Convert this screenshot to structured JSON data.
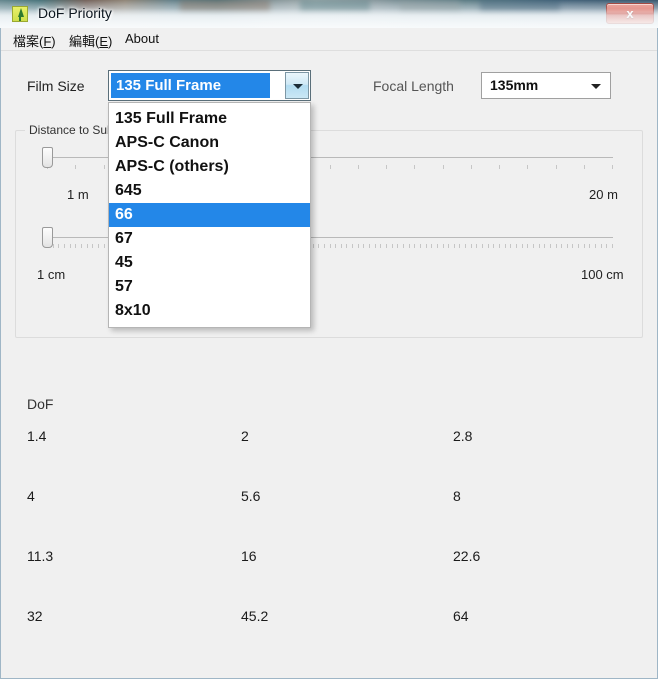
{
  "window": {
    "title": "DoF Priority",
    "icon": "tree-icon",
    "close_label": "x"
  },
  "menubar": {
    "items": [
      {
        "name": "file",
        "text": "檔案(F)",
        "pre": "檔案(",
        "accel": "F",
        "post": ")"
      },
      {
        "name": "edit",
        "text": "編輯(E)",
        "pre": "編輯(",
        "accel": "E",
        "post": ")"
      },
      {
        "name": "about",
        "text": "About",
        "pre": "About",
        "accel": "",
        "post": ""
      }
    ]
  },
  "film_size": {
    "label": "Film Size",
    "selected": "135 Full Frame",
    "highlighted_option": "66",
    "options": [
      "135 Full Frame",
      "APS-C Canon",
      "APS-C (others)",
      "645",
      "66",
      "67",
      "45",
      "57",
      "8x10"
    ],
    "dropdown_open": true,
    "highlight_color": "#2387e8"
  },
  "focal_length": {
    "label": "Focal Length",
    "selected": "135mm"
  },
  "distance_group": {
    "label": "Distance to Sub",
    "sliders": [
      {
        "name": "distance-meters",
        "min_label": "1 m",
        "max_label": "20 m",
        "value_percent": 0,
        "tick_count": 20
      },
      {
        "name": "distance-centimeters",
        "min_label": "1 cm",
        "max_label": "100 cm",
        "value_percent": 0,
        "tick_count": 100
      }
    ]
  },
  "dof": {
    "title": "DoF",
    "rows": [
      [
        "1.4",
        "2",
        "2.8"
      ],
      [
        "4",
        "5.6",
        "8"
      ],
      [
        "11.3",
        "16",
        "22.6"
      ],
      [
        "32",
        "45.2",
        "64"
      ]
    ]
  }
}
